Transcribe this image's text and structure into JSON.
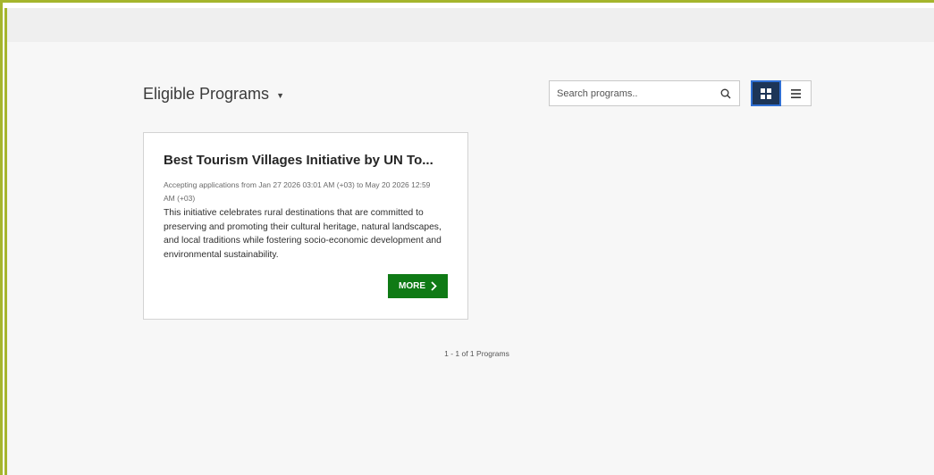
{
  "header": {
    "title": "Eligible Programs"
  },
  "search": {
    "placeholder": "Search programs..",
    "value": ""
  },
  "view_toggle": {
    "active": "grid",
    "options": [
      "grid-view",
      "list-view"
    ]
  },
  "programs": [
    {
      "title": "Best Tourism Villages Initiative by UN To...",
      "dates": "Accepting applications from Jan 27 2026 03:01 AM (+03) to May 20 2026 12:59 AM (+03)",
      "description": "This initiative celebrates rural destinations that are committed to preserving and promoting their cultural heritage, natural landscapes, and local traditions while fostering socio-economic development and environmental sustainability.",
      "more_label": "MORE"
    }
  ],
  "pagination": {
    "summary": "1 - 1 of 1 Programs"
  },
  "colors": {
    "frame_accent": "#a5b52c",
    "primary_button": "#0f7a15",
    "active_toggle": "#1d3557"
  }
}
